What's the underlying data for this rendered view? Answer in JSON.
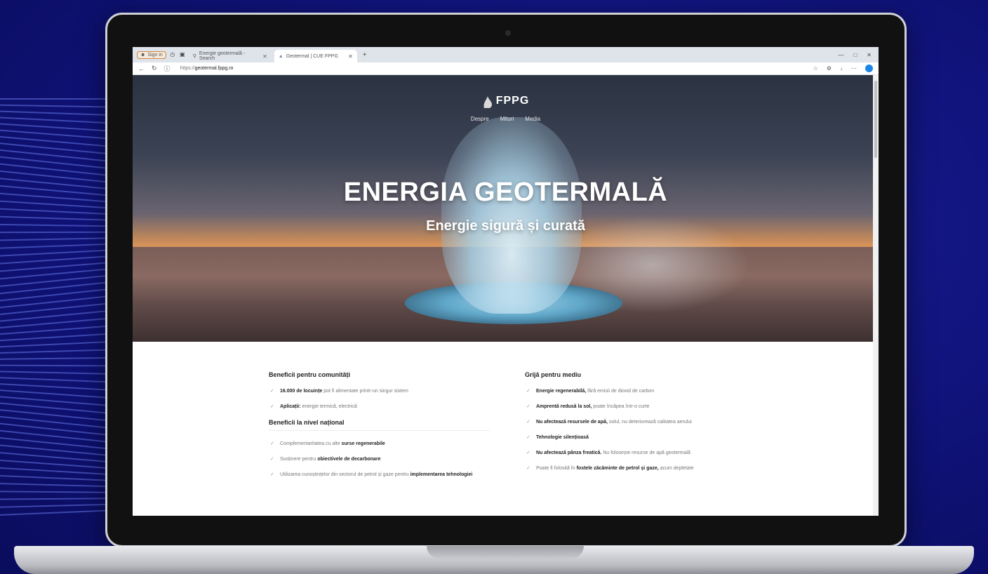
{
  "browser": {
    "badge": "Sign in",
    "tabs": [
      {
        "label": "Energie geotermală - Search"
      },
      {
        "label": "Geotermal | CUE FPPG"
      }
    ],
    "url_prefix": "https://",
    "url_host": "geotermal.fppg.ro"
  },
  "site": {
    "logo_text": "FPPG",
    "menu": [
      "Despre",
      "Mituri",
      "Media"
    ],
    "hero_title": "ENERGIA GEOTERMALĂ",
    "hero_subtitle": "Energie sigură și curată"
  },
  "left": {
    "heading1": "Beneficii pentru comunități",
    "list1": [
      {
        "bold": "16.000 de locuințe",
        "text": " pot fi alimentate printr-un singur sistem"
      },
      {
        "bold": "Aplicații:",
        "text": " energie termică, electrică"
      }
    ],
    "heading2": "Beneficii la nivel național",
    "list2": [
      {
        "pre": "Complementaritatea cu alte ",
        "bold": "surse regenerabile",
        "text": ""
      },
      {
        "pre": "Susținere pentru ",
        "bold": "obiectivele de decarbonare",
        "text": ""
      },
      {
        "pre": "Utilizarea cunoștințelor din sectorul de petrol și gaze pentru ",
        "bold": "implementarea tehnologiei",
        "text": ""
      }
    ]
  },
  "right": {
    "heading": "Grijă pentru mediu",
    "list": [
      {
        "pre": "",
        "bold": "Energie regenerabilă,",
        "text": " fără emisii de dioxid de carbon"
      },
      {
        "pre": "",
        "bold": "Amprentă redusă la sol,",
        "text": " poate încăpea într-o curte"
      },
      {
        "pre": "",
        "bold": "Nu afectează resursele de apă,",
        "text": " solul, nu deteriorează calitatea aerului"
      },
      {
        "pre": "",
        "bold": "Tehnologie silențioasă",
        "text": ""
      },
      {
        "pre": "",
        "bold": "Nu afectează pânza freatică.",
        "text": " Nu folosește resurse de apă geotermală"
      },
      {
        "pre": "Poate fi folosită în ",
        "bold": "fostele zăcăminte de petrol și gaze,",
        "text": " acum depletate"
      }
    ]
  }
}
